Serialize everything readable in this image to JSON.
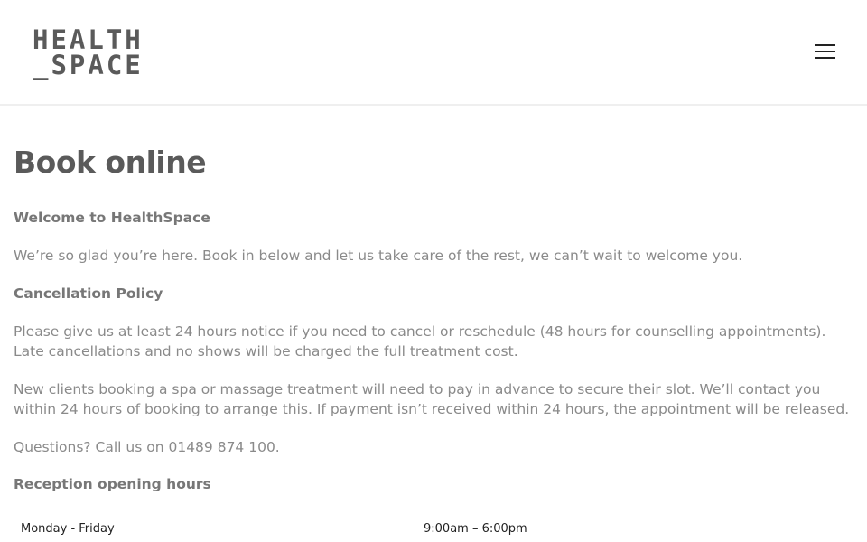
{
  "header": {
    "logo_line1": "HEALTH",
    "logo_line2": "_SPACE",
    "menu_icon": "hamburger-menu-icon"
  },
  "main": {
    "title": "Book online",
    "welcome_heading": "Welcome to HealthSpace",
    "welcome_text": "We’re so glad you’re here. Book in below and let us take care of the rest, we can’t wait to welcome you.",
    "cancellation_heading": "Cancellation Policy",
    "cancellation_text": "Please give us at least 24 hours notice if you need to cancel or reschedule (48 hours for counselling appointments). Late cancellations and no shows will be charged the full treatment cost.",
    "new_clients_text": "New clients booking a spa or massage treatment will need to pay in advance to secure their slot. We’ll contact you within 24 hours of booking to arrange this. If payment isn’t received within 24 hours, the appointment will be released.",
    "questions_text": "Questions? Call us on 01489 874 100.",
    "hours_heading": "Reception opening hours",
    "hours": [
      {
        "day": "Monday - Friday",
        "time": "9:00am – 6:00pm"
      }
    ]
  },
  "colors": {
    "text": "#8a8a8a",
    "heading": "#5a5a5a",
    "logo": "#5a5a5a"
  }
}
